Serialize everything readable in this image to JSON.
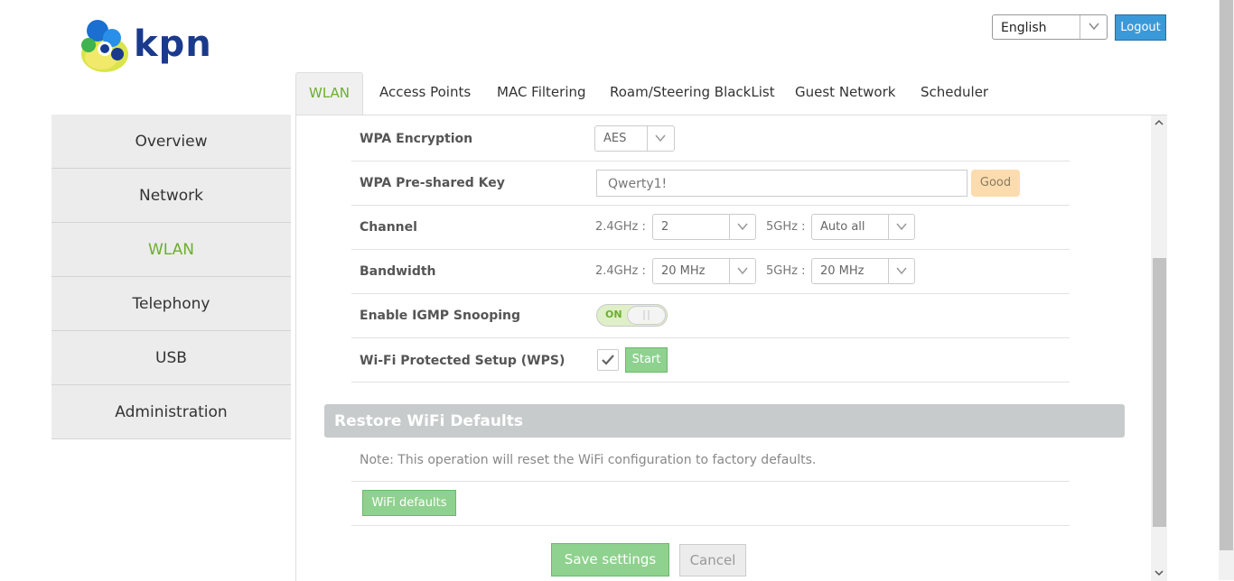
{
  "header": {
    "brand": "kpn",
    "language": "English",
    "logout_label": "Logout"
  },
  "tabs": [
    {
      "label": "WLAN",
      "active": true
    },
    {
      "label": "Access Points",
      "active": false
    },
    {
      "label": "MAC Filtering",
      "active": false
    },
    {
      "label": "Roam/Steering BlackList",
      "active": false
    },
    {
      "label": "Guest Network",
      "active": false
    },
    {
      "label": "Scheduler",
      "active": false
    }
  ],
  "sidebar": {
    "items": [
      {
        "label": "Overview",
        "active": false
      },
      {
        "label": "Network",
        "active": false
      },
      {
        "label": "WLAN",
        "active": true
      },
      {
        "label": "Telephony",
        "active": false
      },
      {
        "label": "USB",
        "active": false
      },
      {
        "label": "Administration",
        "active": false
      }
    ]
  },
  "settings": {
    "wpa_encryption": {
      "label": "WPA Encryption",
      "value": "AES"
    },
    "wpa_key": {
      "label": "WPA Pre-shared Key",
      "value": "Qwerty1!",
      "strength": "Good"
    },
    "channel": {
      "label": "Channel",
      "band24_label": "2.4GHz :",
      "band24_value": "2",
      "band5_label": "5GHz :",
      "band5_value": "Auto all"
    },
    "bandwidth": {
      "label": "Bandwidth",
      "band24_label": "2.4GHz :",
      "band24_value": "20 MHz",
      "band5_label": "5GHz :",
      "band5_value": "20 MHz"
    },
    "igmp": {
      "label": "Enable IGMP Snooping",
      "toggle_text": "ON"
    },
    "wps": {
      "label": "Wi-Fi Protected Setup (WPS)",
      "checked": true,
      "start_label": "Start"
    }
  },
  "restore": {
    "title": "Restore WiFi Defaults",
    "note": "Note: This operation will reset the WiFi configuration to factory defaults.",
    "button_label": "WiFi defaults"
  },
  "actions": {
    "save_label": "Save settings",
    "cancel_label": "Cancel"
  },
  "colors": {
    "accent_green": "#6cae2e",
    "button_green": "#8fd18f",
    "logout_blue": "#3a9ad9",
    "strength_orange": "#fcdcae"
  }
}
